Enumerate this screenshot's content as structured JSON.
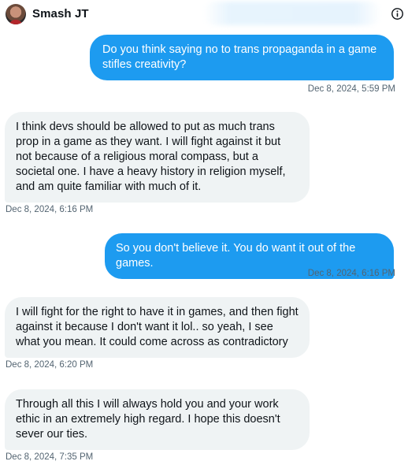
{
  "header": {
    "contact_name": "Smash JT",
    "info_icon": "info-icon"
  },
  "messages": [
    {
      "direction": "sent",
      "text": "Do you think saying no to trans propaganda in a game stifles creativity?",
      "timestamp": "Dec 8, 2024, 5:59 PM"
    },
    {
      "direction": "received",
      "text": "I think devs should be allowed to put as much trans prop in a game as they want. I will fight against it but not because of a religious moral compass, but a societal one. I have a heavy history in religion myself, and am quite familiar with much of it.",
      "timestamp": "Dec 8, 2024, 6:16 PM"
    },
    {
      "direction": "sent",
      "text": "So you don't believe it. You do want it out of the games.",
      "timestamp": "Dec 8, 2024, 6:16 PM"
    },
    {
      "direction": "received",
      "text": "I will fight for the right to have it in games, and then fight against it because I don't want it lol.. so yeah, I see what you mean. It could come across as contradictory",
      "timestamp": "Dec 8, 2024, 6:20 PM"
    },
    {
      "direction": "received",
      "text": "Through all this I will always hold you and your work ethic in an extremely high regard. I hope this doesn't sever our ties.",
      "timestamp": "Dec 8, 2024, 7:35 PM"
    }
  ],
  "colors": {
    "sent_bubble": "#1d9bf0",
    "received_bubble": "#eff3f4",
    "timestamp": "#536471"
  }
}
